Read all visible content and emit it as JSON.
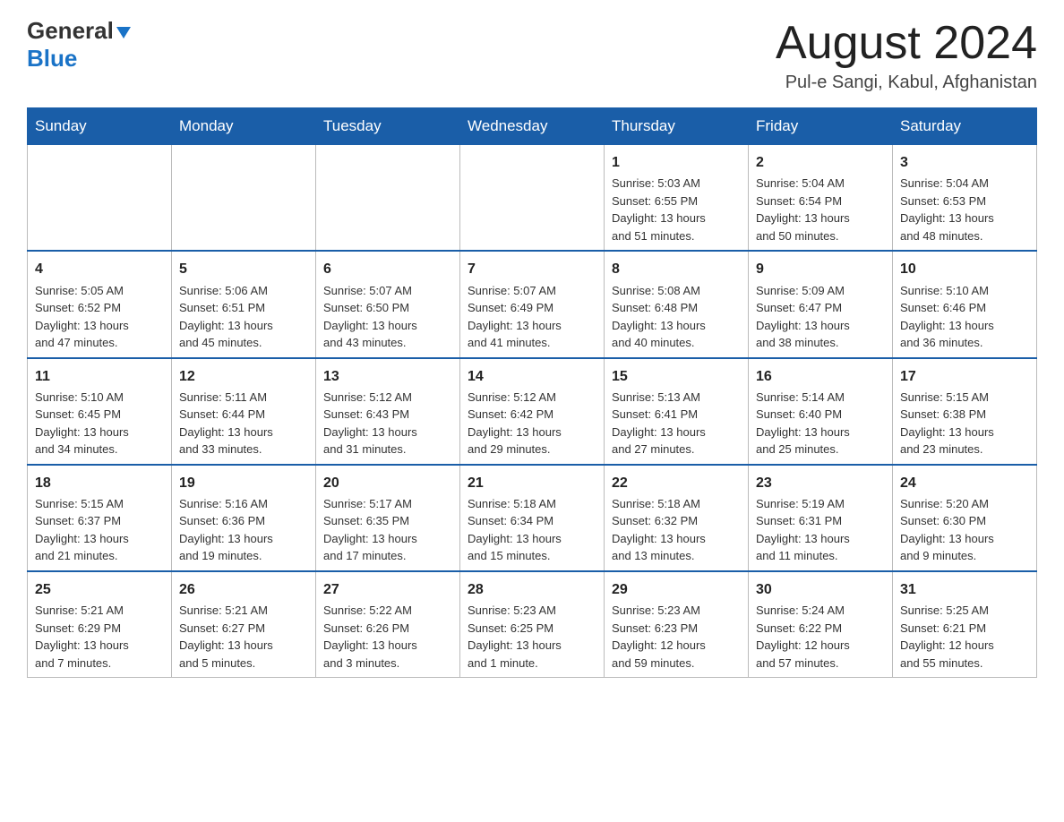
{
  "header": {
    "logo_line1": "General",
    "logo_line2": "Blue",
    "title": "August 2024",
    "subtitle": "Pul-e Sangi, Kabul, Afghanistan"
  },
  "calendar": {
    "days_of_week": [
      "Sunday",
      "Monday",
      "Tuesday",
      "Wednesday",
      "Thursday",
      "Friday",
      "Saturday"
    ],
    "weeks": [
      [
        {
          "day": "",
          "info": ""
        },
        {
          "day": "",
          "info": ""
        },
        {
          "day": "",
          "info": ""
        },
        {
          "day": "",
          "info": ""
        },
        {
          "day": "1",
          "info": "Sunrise: 5:03 AM\nSunset: 6:55 PM\nDaylight: 13 hours\nand 51 minutes."
        },
        {
          "day": "2",
          "info": "Sunrise: 5:04 AM\nSunset: 6:54 PM\nDaylight: 13 hours\nand 50 minutes."
        },
        {
          "day": "3",
          "info": "Sunrise: 5:04 AM\nSunset: 6:53 PM\nDaylight: 13 hours\nand 48 minutes."
        }
      ],
      [
        {
          "day": "4",
          "info": "Sunrise: 5:05 AM\nSunset: 6:52 PM\nDaylight: 13 hours\nand 47 minutes."
        },
        {
          "day": "5",
          "info": "Sunrise: 5:06 AM\nSunset: 6:51 PM\nDaylight: 13 hours\nand 45 minutes."
        },
        {
          "day": "6",
          "info": "Sunrise: 5:07 AM\nSunset: 6:50 PM\nDaylight: 13 hours\nand 43 minutes."
        },
        {
          "day": "7",
          "info": "Sunrise: 5:07 AM\nSunset: 6:49 PM\nDaylight: 13 hours\nand 41 minutes."
        },
        {
          "day": "8",
          "info": "Sunrise: 5:08 AM\nSunset: 6:48 PM\nDaylight: 13 hours\nand 40 minutes."
        },
        {
          "day": "9",
          "info": "Sunrise: 5:09 AM\nSunset: 6:47 PM\nDaylight: 13 hours\nand 38 minutes."
        },
        {
          "day": "10",
          "info": "Sunrise: 5:10 AM\nSunset: 6:46 PM\nDaylight: 13 hours\nand 36 minutes."
        }
      ],
      [
        {
          "day": "11",
          "info": "Sunrise: 5:10 AM\nSunset: 6:45 PM\nDaylight: 13 hours\nand 34 minutes."
        },
        {
          "day": "12",
          "info": "Sunrise: 5:11 AM\nSunset: 6:44 PM\nDaylight: 13 hours\nand 33 minutes."
        },
        {
          "day": "13",
          "info": "Sunrise: 5:12 AM\nSunset: 6:43 PM\nDaylight: 13 hours\nand 31 minutes."
        },
        {
          "day": "14",
          "info": "Sunrise: 5:12 AM\nSunset: 6:42 PM\nDaylight: 13 hours\nand 29 minutes."
        },
        {
          "day": "15",
          "info": "Sunrise: 5:13 AM\nSunset: 6:41 PM\nDaylight: 13 hours\nand 27 minutes."
        },
        {
          "day": "16",
          "info": "Sunrise: 5:14 AM\nSunset: 6:40 PM\nDaylight: 13 hours\nand 25 minutes."
        },
        {
          "day": "17",
          "info": "Sunrise: 5:15 AM\nSunset: 6:38 PM\nDaylight: 13 hours\nand 23 minutes."
        }
      ],
      [
        {
          "day": "18",
          "info": "Sunrise: 5:15 AM\nSunset: 6:37 PM\nDaylight: 13 hours\nand 21 minutes."
        },
        {
          "day": "19",
          "info": "Sunrise: 5:16 AM\nSunset: 6:36 PM\nDaylight: 13 hours\nand 19 minutes."
        },
        {
          "day": "20",
          "info": "Sunrise: 5:17 AM\nSunset: 6:35 PM\nDaylight: 13 hours\nand 17 minutes."
        },
        {
          "day": "21",
          "info": "Sunrise: 5:18 AM\nSunset: 6:34 PM\nDaylight: 13 hours\nand 15 minutes."
        },
        {
          "day": "22",
          "info": "Sunrise: 5:18 AM\nSunset: 6:32 PM\nDaylight: 13 hours\nand 13 minutes."
        },
        {
          "day": "23",
          "info": "Sunrise: 5:19 AM\nSunset: 6:31 PM\nDaylight: 13 hours\nand 11 minutes."
        },
        {
          "day": "24",
          "info": "Sunrise: 5:20 AM\nSunset: 6:30 PM\nDaylight: 13 hours\nand 9 minutes."
        }
      ],
      [
        {
          "day": "25",
          "info": "Sunrise: 5:21 AM\nSunset: 6:29 PM\nDaylight: 13 hours\nand 7 minutes."
        },
        {
          "day": "26",
          "info": "Sunrise: 5:21 AM\nSunset: 6:27 PM\nDaylight: 13 hours\nand 5 minutes."
        },
        {
          "day": "27",
          "info": "Sunrise: 5:22 AM\nSunset: 6:26 PM\nDaylight: 13 hours\nand 3 minutes."
        },
        {
          "day": "28",
          "info": "Sunrise: 5:23 AM\nSunset: 6:25 PM\nDaylight: 13 hours\nand 1 minute."
        },
        {
          "day": "29",
          "info": "Sunrise: 5:23 AM\nSunset: 6:23 PM\nDaylight: 12 hours\nand 59 minutes."
        },
        {
          "day": "30",
          "info": "Sunrise: 5:24 AM\nSunset: 6:22 PM\nDaylight: 12 hours\nand 57 minutes."
        },
        {
          "day": "31",
          "info": "Sunrise: 5:25 AM\nSunset: 6:21 PM\nDaylight: 12 hours\nand 55 minutes."
        }
      ]
    ]
  }
}
